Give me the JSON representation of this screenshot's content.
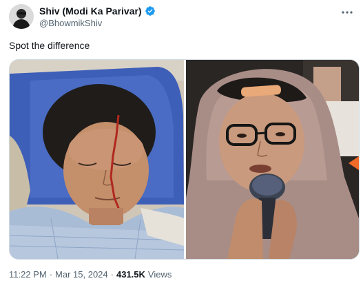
{
  "author": {
    "display_name": "Shiv (Modi Ka Parivar)",
    "handle": "@BhowmikShiv",
    "verified": true,
    "verified_color": "#1d9bf0",
    "avatar_icon": "person-silhouette-icon"
  },
  "tweet": {
    "text": "Spot the difference"
  },
  "media": {
    "left_photo": "woman-in-hospital-bed-with-forehead-wound",
    "right_photo": "woman-in-headscarf-with-glasses-speaking-into-microphone"
  },
  "meta": {
    "time": "11:22 PM",
    "separator": "·",
    "date": "Mar 15, 2024",
    "views_count": "431.5K",
    "views_label": "Views"
  },
  "colors": {
    "text_primary": "#0f1419",
    "text_secondary": "#536471",
    "verified_blue": "#1d9bf0"
  }
}
